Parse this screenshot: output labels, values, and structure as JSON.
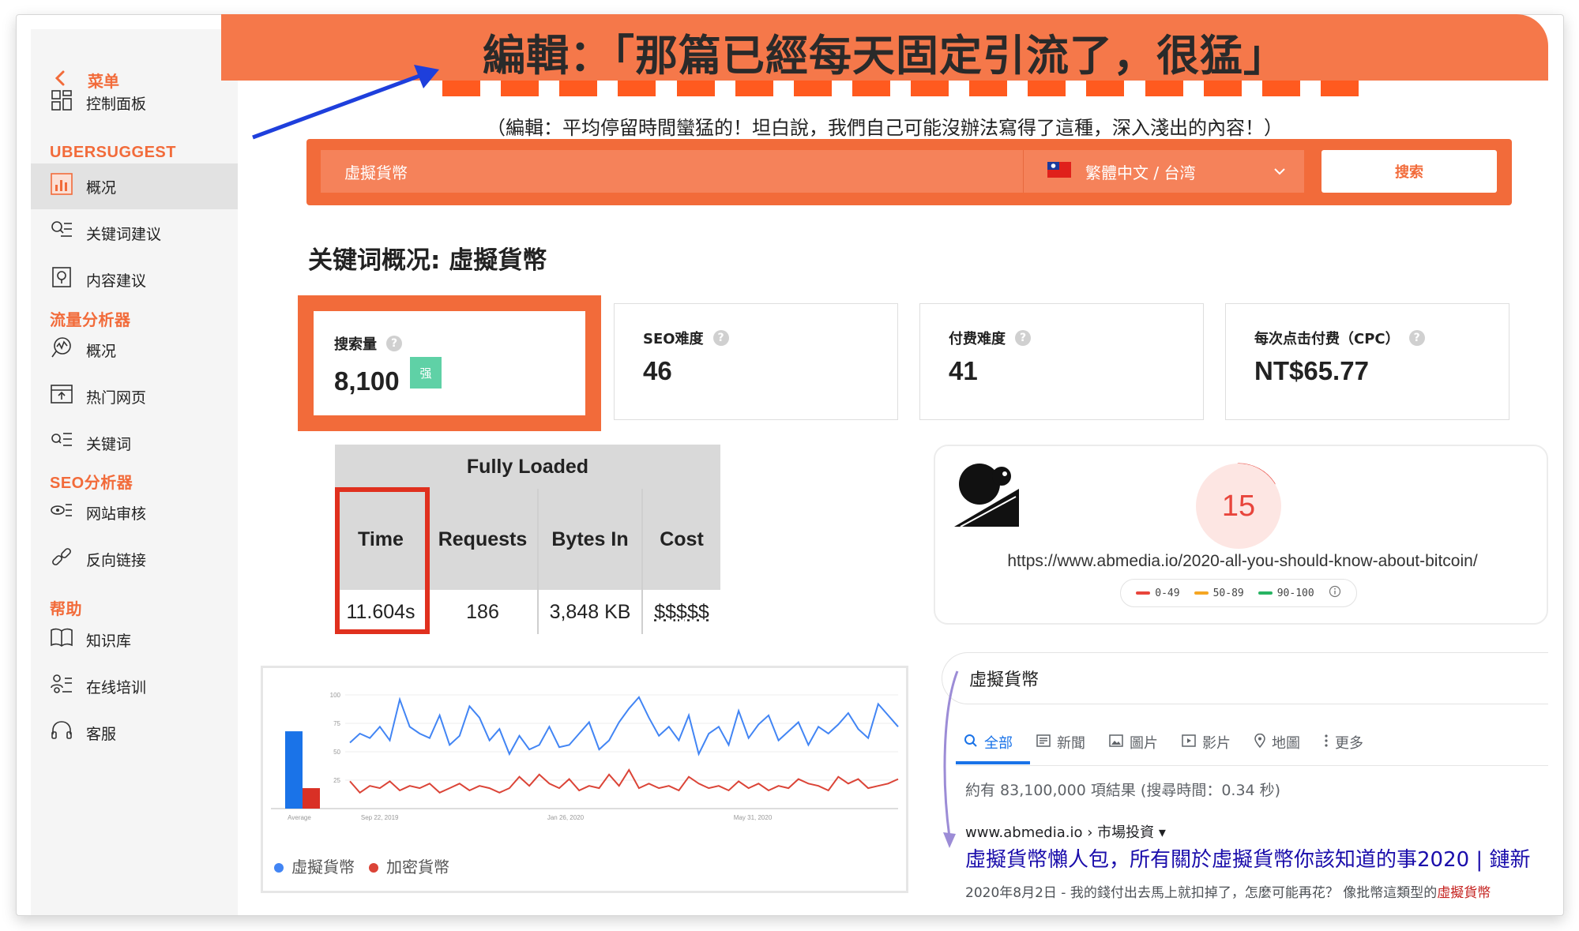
{
  "headline": "編輯：「那篇已經每天固定引流了，很猛」",
  "subline": "（編輯：平均停留時間蠻猛的！坦白說，我們自己可能沒辦法寫得了這種，深入淺出的內容！）",
  "sidebar": {
    "back_label": "菜单",
    "dashboard": "控制面板",
    "section_ubersuggest": "UBERSUGGEST",
    "ubersuggest_items": [
      "概况",
      "关键词建议",
      "内容建议"
    ],
    "section_traffic": "流量分析器",
    "traffic_items": [
      "概况",
      "热门网页",
      "关键词"
    ],
    "section_seo": "SEO分析器",
    "seo_items": [
      "网站审核",
      "反向链接"
    ],
    "section_help": "帮助",
    "help_items": [
      "知识库",
      "在线培训",
      "客服"
    ]
  },
  "search": {
    "keyword": "虛擬貨幣",
    "language": "繁體中文 / 台湾",
    "button": "搜索"
  },
  "overview_title": "关键词概况: 虛擬貨幣",
  "metrics": {
    "volume_label": "搜索量",
    "volume_value": "8,100",
    "volume_badge": "强",
    "seo_label": "SEO难度",
    "seo_value": "46",
    "paid_label": "付费难度",
    "paid_value": "41",
    "cpc_label": "每次点击付费（CPC）",
    "cpc_value": "NT$65.77"
  },
  "fully_loaded": {
    "title": "Fully Loaded",
    "headers": [
      "Time",
      "Requests",
      "Bytes In",
      "Cost"
    ],
    "values": [
      "11.604s",
      "186",
      "3,848 KB",
      "$$$$$"
    ]
  },
  "speed": {
    "score": "15",
    "url": "https://www.abmedia.io/2020-all-you-should-know-about-bitcoin/",
    "legend": [
      "0-49",
      "50-89",
      "90-100"
    ],
    "colors": {
      "bad": "#e8453c",
      "mid": "#f5a623",
      "good": "#28b463"
    }
  },
  "chart_data": {
    "type": "line",
    "y_ticks": [
      "100",
      "75",
      "50",
      "25"
    ],
    "ylim": [
      0,
      100
    ],
    "x_tick_labels": [
      "Sep 22, 2019",
      "Jan 26, 2020",
      "May 31, 2020"
    ],
    "average_label": "Average",
    "average_values": [
      68,
      18
    ],
    "series": [
      {
        "name": "虛擬貨幣",
        "color": "#4285f4",
        "values": [
          58,
          66,
          62,
          72,
          60,
          96,
          72,
          66,
          62,
          82,
          56,
          64,
          90,
          80,
          60,
          70,
          48,
          64,
          52,
          56,
          72,
          54,
          56,
          66,
          76,
          52,
          60,
          76,
          88,
          98,
          80,
          64,
          72,
          60,
          82,
          48,
          66,
          72,
          56,
          86,
          62,
          74,
          82,
          60,
          68,
          76,
          56,
          72,
          66,
          74,
          84,
          70,
          62,
          92,
          82,
          72
        ]
      },
      {
        "name": "加密貨幣",
        "color": "#db4437",
        "values": [
          24,
          14,
          20,
          18,
          24,
          16,
          20,
          18,
          22,
          14,
          18,
          22,
          16,
          20,
          18,
          14,
          18,
          28,
          20,
          30,
          22,
          18,
          26,
          16,
          20,
          18,
          30,
          20,
          34,
          18,
          22,
          18,
          20,
          16,
          28,
          22,
          18,
          20,
          16,
          24,
          18,
          22,
          16,
          20,
          18,
          26,
          22,
          20,
          16,
          28,
          22,
          26,
          18,
          20,
          22,
          26
        ]
      }
    ]
  },
  "serp": {
    "query": "虛擬貨幣",
    "tabs": [
      "全部",
      "新聞",
      "圖片",
      "影片",
      "地圖",
      "更多"
    ],
    "count": "約有 83,100,000 項結果 (搜尋時間：0.34 秒)",
    "crumb": "www.abmedia.io › 市場投資",
    "title": "虛擬貨幣懶人包，所有關於虛擬貨幣你該知道的事2020 | 鏈新",
    "snippet_main": "2020年8月2日 - 我的錢付出去馬上就扣掉了，怎麼可能再花？ 像批幣這類型的",
    "snippet_highlight": "虛擬貨幣"
  }
}
